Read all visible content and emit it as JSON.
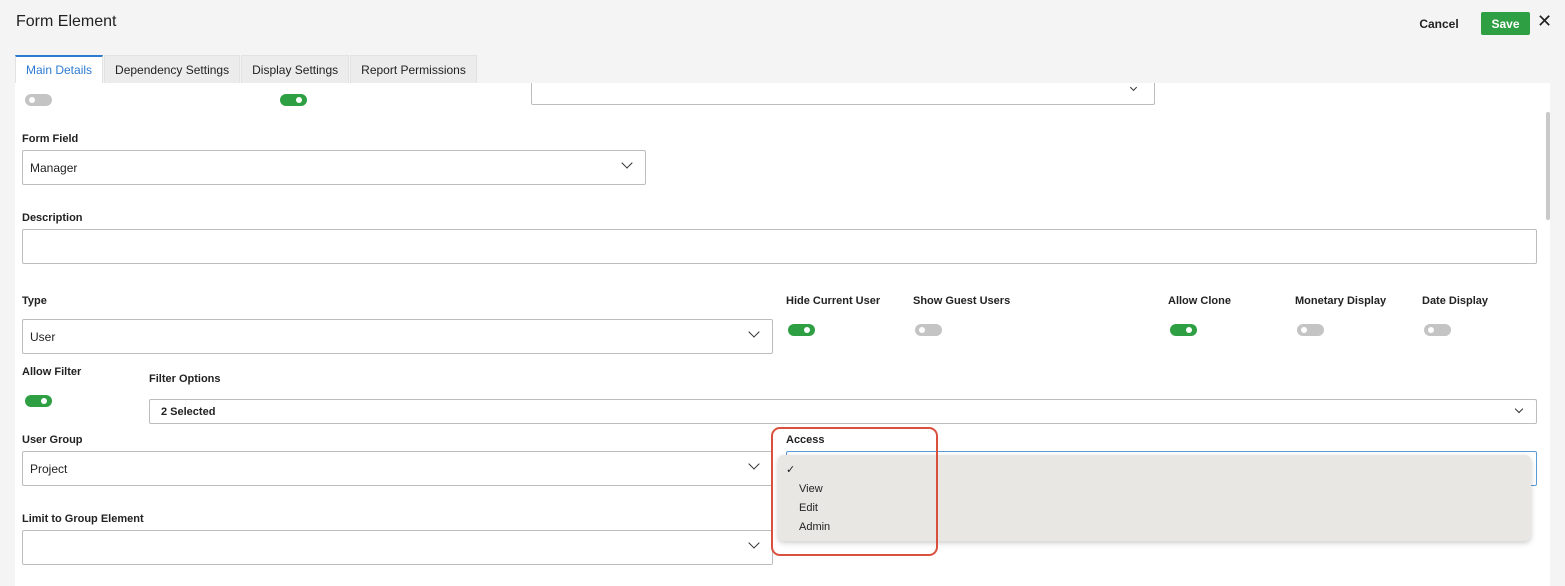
{
  "header": {
    "title": "Form Element",
    "cancel_label": "Cancel",
    "save_label": "Save",
    "close_glyph": "✕"
  },
  "tabs": [
    {
      "label": "Main Details",
      "active": true
    },
    {
      "label": "Dependency Settings",
      "active": false
    },
    {
      "label": "Display Settings",
      "active": false
    },
    {
      "label": "Report Permissions",
      "active": false
    }
  ],
  "form": {
    "top_toggles": {
      "first": "off",
      "second": "on"
    },
    "top_select_value": "",
    "form_field": {
      "label": "Form Field",
      "value": "Manager"
    },
    "description": {
      "label": "Description",
      "value": ""
    },
    "type": {
      "label": "Type",
      "value": "User"
    },
    "toggles": {
      "hide_current_user": {
        "label": "Hide Current User",
        "state": "on"
      },
      "show_guest_users": {
        "label": "Show Guest Users",
        "state": "off"
      },
      "allow_clone": {
        "label": "Allow Clone",
        "state": "on"
      },
      "monetary_display": {
        "label": "Monetary Display",
        "state": "off"
      },
      "date_display": {
        "label": "Date Display",
        "state": "off"
      },
      "allow_filter": {
        "label": "Allow Filter",
        "state": "on"
      }
    },
    "filter_options": {
      "label": "Filter Options",
      "value": "2 Selected"
    },
    "user_group": {
      "label": "User Group",
      "value": "Project"
    },
    "access": {
      "label": "Access",
      "selected": "",
      "check_glyph": "✓",
      "options": [
        "View",
        "Edit",
        "Admin"
      ]
    },
    "limit_to_group_element": {
      "label": "Limit to Group Element",
      "value": ""
    }
  },
  "colors": {
    "accent_green": "#2ea043",
    "tab_active_blue": "#2d7bd0",
    "highlight_red": "#d9503f"
  }
}
